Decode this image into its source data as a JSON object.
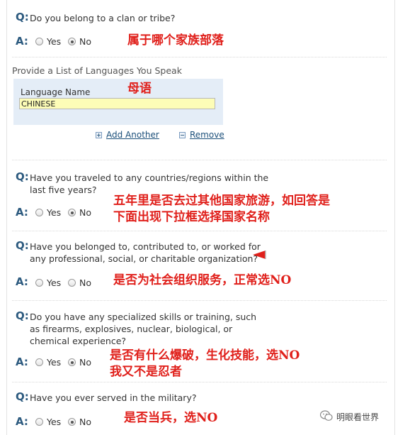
{
  "q1": {
    "label": "Q:",
    "text": "Do you belong to a clan or tribe?",
    "answer_label": "A:",
    "yes": "Yes",
    "no": "No",
    "selected": "No",
    "note": "属于哪个家族部落"
  },
  "languages": {
    "title": "Provide a List of Languages You Speak",
    "field_label": "Language Name",
    "value": "CHINESE",
    "note": "母语",
    "add": "Add Another",
    "remove": "Remove"
  },
  "q2": {
    "label": "Q:",
    "text": "Have you traveled to any countries/regions within the last five years?",
    "answer_label": "A:",
    "yes": "Yes",
    "no": "No",
    "selected": "No",
    "note_line1": "五年里是否去过其他国家旅游，如回答是",
    "note_line2": "下面出现下拉框选择国家名称"
  },
  "q3": {
    "label": "Q:",
    "text": "Have you belonged to, contributed to, or worked for any professional, social, or charitable organization?",
    "answer_label": "A:",
    "yes": "Yes",
    "no": "No",
    "selected": "none",
    "note": "是否为社会组织服务，正常选NO"
  },
  "q4": {
    "label": "Q:",
    "text": "Do you have any specialized skills or training, such as firearms, explosives, nuclear, biological, or chemical experience?",
    "answer_label": "A:",
    "yes": "Yes",
    "no": "No",
    "selected": "No",
    "note_line1": "是否有什么爆破，生化技能，选NO",
    "note_line2": "我又不是忍者"
  },
  "q5": {
    "label": "Q:",
    "text": "Have you ever served in the military?",
    "answer_label": "A:",
    "yes": "Yes",
    "no": "No",
    "selected": "No",
    "note": "是否当兵，选NO"
  },
  "watermark": {
    "text": "明眼看世界"
  },
  "colors": {
    "label_blue": "#2c5a7f",
    "note_red": "#e0201b",
    "input_yellow": "#fdfdb7",
    "panel_blue": "#e4edf7"
  }
}
